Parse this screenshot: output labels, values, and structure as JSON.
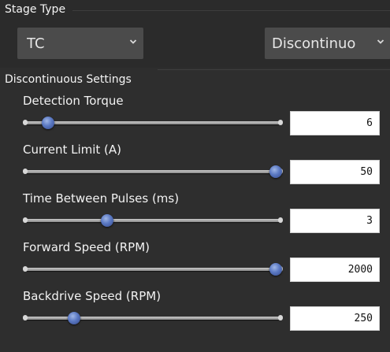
{
  "stage_type": {
    "title": "Stage Type",
    "type_select": {
      "value": "TC"
    },
    "mode_select": {
      "value": "Discontinuo"
    }
  },
  "discontinuous": {
    "title": "Discontinuous Settings",
    "settings": [
      {
        "label": "Detection Torque",
        "value": "6",
        "level": 0.09
      },
      {
        "label": "Current Limit (A)",
        "value": "50",
        "level": 0.98
      },
      {
        "label": "Time Between Pulses (ms)",
        "value": "3",
        "level": 0.32
      },
      {
        "label": "Forward Speed (RPM)",
        "value": "2000",
        "level": 0.98
      },
      {
        "label": "Backdrive Speed (RPM)",
        "value": "250",
        "level": 0.19
      }
    ]
  },
  "colors": {
    "background": "#262626",
    "panel": "#2e2e2e",
    "select_bg": "#4b4b4b",
    "thumb": "#5a78c2"
  },
  "icons": {
    "select_chevron": "chevron-down-icon"
  }
}
